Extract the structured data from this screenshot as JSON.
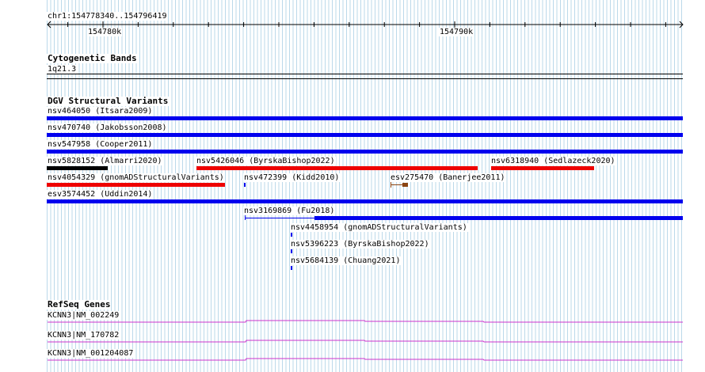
{
  "region_label": "chr1:154778340..154796419",
  "ruler": {
    "labels": [
      {
        "text": "154780k",
        "bp": 154780000
      },
      {
        "text": "154790k",
        "bp": 154790000
      }
    ]
  },
  "tracks": {
    "cytoband": {
      "title": "Cytogenetic Bands",
      "band": "1q21.3"
    },
    "dgv": {
      "title": "DGV Structural Variants",
      "colors": {
        "blue": "#0000ee",
        "red": "#ee0000",
        "black": "#000000",
        "brown": "#8b4513"
      }
    },
    "refseq": {
      "title": "RefSeq Genes",
      "color": "#cc33cc",
      "genes": [
        {
          "label": "KCNN3|NM_002249"
        },
        {
          "label": "KCNN3|NM_170782"
        },
        {
          "label": "KCNN3|NM_001204087"
        }
      ]
    }
  },
  "variants": [
    {
      "label": "nsv464050 (Itsara2009)",
      "color": "blue",
      "row": 0
    },
    {
      "label": "nsv470740 (Jakobsson2008)",
      "color": "blue",
      "row": 1
    },
    {
      "label": "nsv547958 (Cooper2011)",
      "color": "blue",
      "row": 2
    },
    {
      "label": "nsv5828152 (Almarri2020)",
      "color": "black",
      "row": 3
    },
    {
      "label": "nsv5426046 (ByrskaBishop2022)",
      "color": "red",
      "row": 3
    },
    {
      "label": "nsv6318940 (Sedlazeck2020)",
      "color": "red",
      "row": 3
    },
    {
      "label": "nsv4054329 (gnomADStructuralVariants)",
      "color": "red",
      "row": 4
    },
    {
      "label": "nsv472399 (Kidd2010)",
      "color": "blue",
      "row": 4
    },
    {
      "label": "esv275470 (Banerjee2011)",
      "color": "brown",
      "row": 4
    },
    {
      "label": "esv3574452 (Uddin2014)",
      "color": "blue",
      "row": 5
    },
    {
      "label": "nsv3169869 (Fu2018)",
      "color": "blue",
      "row": 6
    },
    {
      "label": "nsv4458954 (gnomADStructuralVariants)",
      "color": "blue",
      "row": 7
    },
    {
      "label": "nsv5396223 (ByrskaBishop2022)",
      "color": "blue",
      "row": 8
    },
    {
      "label": "nsv5684139 (Chuang2021)",
      "color": "blue",
      "row": 9
    }
  ]
}
